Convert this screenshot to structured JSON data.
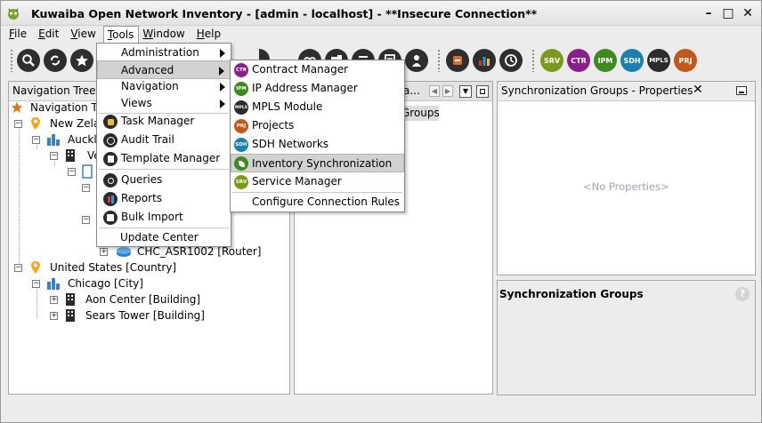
{
  "window": {
    "title": "Kuwaiba Open Network Inventory - [admin - localhost] - **Insecure Connection**",
    "controls": [
      "–",
      "□",
      "✕"
    ]
  },
  "menubar": {
    "items": [
      {
        "label": "File",
        "key": "F",
        "rest": "ile"
      },
      {
        "label": "Edit",
        "key": "E",
        "rest": "dit"
      },
      {
        "label": "View",
        "key": "V",
        "rest": "iew"
      },
      {
        "label": "Tools",
        "key": "T",
        "rest": "ools"
      },
      {
        "label": "Window",
        "key": "W",
        "rest": "indow"
      },
      {
        "label": "Help",
        "key": "H",
        "rest": "elp"
      }
    ]
  },
  "toolbar": {
    "badges": [
      "SRV",
      "CTR",
      "IPM",
      "SDH",
      "MPLS",
      "PRJ"
    ],
    "colors": {
      "srv": "#7a9a1c",
      "ctr": "#8a1e8a",
      "ipm": "#3d8a1f",
      "sdh": "#1b7fb0",
      "mpls": "#2c2c2c",
      "prj": "#c4571a"
    }
  },
  "nav_tree": {
    "header": "Navigation Tree",
    "rows": [
      {
        "label": "Navigation Tr"
      },
      {
        "label": "New Zela"
      },
      {
        "label": "Auckla"
      },
      {
        "label": "Ve"
      },
      {
        "label": "CHC_ASR1002 [Router]"
      },
      {
        "label": "United States [Country]"
      },
      {
        "label": "Chicago [City]"
      },
      {
        "label": "Aon Center [Building]"
      },
      {
        "label": "Sears Tower [Building]"
      }
    ]
  },
  "sync_panel": {
    "header_fragment": "a...",
    "groups_fragment": "Groups"
  },
  "properties_panel": {
    "header": "Synchronization Groups - Properties",
    "empty_text": "<No Properties>",
    "section_title": "Synchronization Groups"
  },
  "tools_menu": {
    "items": [
      {
        "label": "Administration"
      },
      {
        "label": "Advanced"
      },
      {
        "label": "Navigation"
      },
      {
        "label": "Views"
      },
      {
        "label": "Task Manager"
      },
      {
        "label": "Audit Trail"
      },
      {
        "label": "Template Manager"
      },
      {
        "label": "Queries"
      },
      {
        "label": "Reports"
      },
      {
        "label": "Bulk Import"
      },
      {
        "label": "Update Center"
      }
    ]
  },
  "advanced_menu": {
    "items": [
      {
        "label": "Contract Manager",
        "badge": "CTR",
        "color": "#8a1e8a"
      },
      {
        "label": "IP Address Manager",
        "badge": "IPM",
        "color": "#3d8a1f"
      },
      {
        "label": "MPLS Module",
        "badge": "MPLS",
        "color": "#2c2c2c"
      },
      {
        "label": "Projects",
        "badge": "PRJ",
        "color": "#c4571a"
      },
      {
        "label": "SDH Networks",
        "badge": "SDH",
        "color": "#1b7fb0"
      },
      {
        "label": "Inventory Synchronization",
        "badge": "",
        "color": "#3d8a1f"
      },
      {
        "label": "Service Manager",
        "badge": "SRV",
        "color": "#7a9a1c"
      },
      {
        "label": "Configure Connection Rules",
        "badge": "",
        "color": ""
      }
    ]
  }
}
